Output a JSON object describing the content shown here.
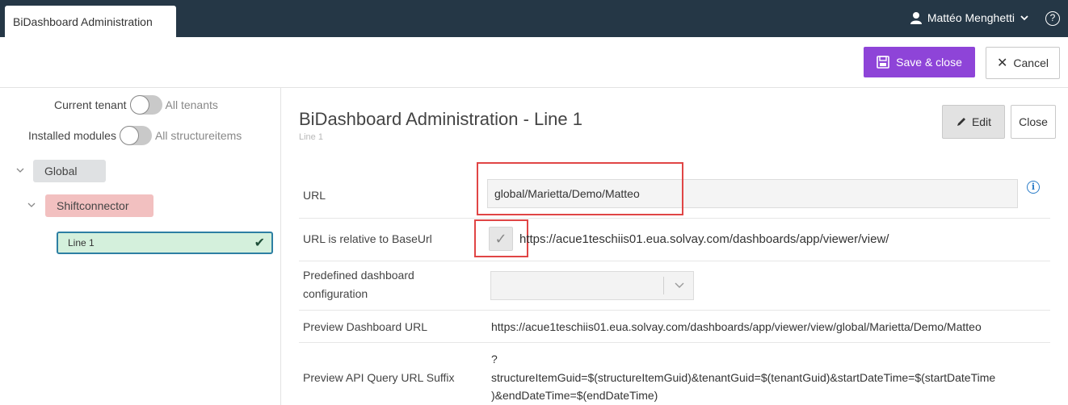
{
  "app": {
    "tab_title": "BiDashboard Administration"
  },
  "user": {
    "name": "Mattéo Menghetti",
    "menu_chevron": "chevron-down-icon",
    "help_icon": "?"
  },
  "toolbar": {
    "save_label": "Save & close",
    "cancel_label": "Cancel",
    "save_color": "#8e44d8"
  },
  "sidebar": {
    "tenant_toggle": {
      "left_label": "Current tenant",
      "right_label": "All tenants"
    },
    "modules_toggle": {
      "left_label": "Installed modules",
      "right_label": "All structureitems"
    },
    "tree": {
      "global": "Global",
      "shiftconnector": "Shiftconnector",
      "line": "Line 1"
    }
  },
  "main": {
    "title": "BiDashboard Administration - Line 1",
    "subtitle": "Line 1",
    "edit_label": "Edit",
    "close_label": "Close",
    "fields": {
      "url_label": "URL",
      "url_value": "global/Marietta/Demo/Matteo",
      "relative_label": "URL is relative to BaseUrl",
      "relative_checked": true,
      "base_url": "https://acue1teschiis01.eua.solvay.com/dashboards/app/viewer/view/",
      "predefined_label_line1": "Predefined dashboard",
      "predefined_label_line2": "configuration",
      "predefined_value": "",
      "preview_url_label": "Preview Dashboard URL",
      "preview_url_value": "https://acue1teschiis01.eua.solvay.com/dashboards/app/viewer/view/global/Marietta/Demo/Matteo",
      "api_label": "Preview API Query URL Suffix",
      "api_line1": "?",
      "api_line2": "structureItemGuid=$(structureItemGuid)&tenantGuid=$(tenantGuid)&startDateTime=$(startDateTime",
      "api_line3": ")&endDateTime=$(endDateTime)"
    }
  }
}
